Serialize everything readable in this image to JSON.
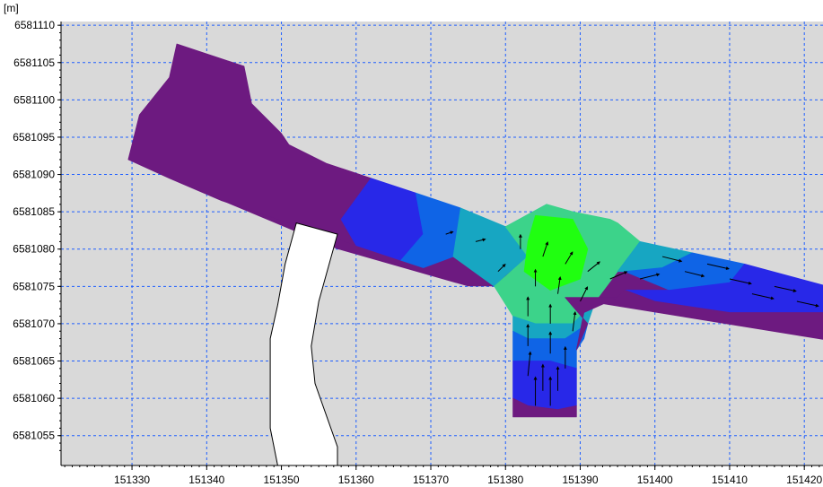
{
  "chart_data": {
    "type": "heatmap",
    "title": "",
    "xlabel": "",
    "ylabel": "",
    "y_unit": "[m]",
    "xlim": [
      151320.5,
      151422.5
    ],
    "ylim": [
      6581051,
      6581110.5
    ],
    "x_ticks": [
      151330,
      151340,
      151350,
      151360,
      151370,
      151380,
      151390,
      151400,
      151410,
      151420
    ],
    "y_ticks": [
      6581055,
      6581060,
      6581065,
      6581070,
      6581075,
      6581080,
      6581085,
      6581090,
      6581095,
      6581100,
      6581105,
      6581110
    ],
    "x_tick_labels": [
      "151330",
      "151340",
      "151350",
      "151360",
      "151370",
      "151380",
      "151390",
      "151400",
      "151410",
      "151420"
    ],
    "y_tick_labels": [
      "6581055",
      "6581060",
      "6581065",
      "6581070",
      "6581075",
      "6581080",
      "6581085",
      "6581090",
      "6581095",
      "6581100",
      "6581105",
      "6581110"
    ],
    "grid": true,
    "colors": {
      "background": "#d9d9d9",
      "grid": "#1f5fff",
      "low": "#6d1a80",
      "mid_low": "#2828e8",
      "mid": "#0f64e6",
      "mid_high": "#17a6c2",
      "high_low": "#3cd38a",
      "high": "#20ff10",
      "inflow_channel": "#ffffff"
    },
    "domain_outline": [
      [
        151336,
        6581107.5
      ],
      [
        151345,
        6581104.5
      ],
      [
        151346,
        6581099.5
      ],
      [
        151350,
        6581095.5
      ],
      [
        151351,
        6581094
      ],
      [
        151356,
        6581091.5
      ],
      [
        151360.5,
        6581090
      ],
      [
        151380,
        6581083
      ],
      [
        151385.5,
        6581086
      ],
      [
        151389,
        6581085
      ],
      [
        151394,
        6581084
      ],
      [
        151395,
        6581083.5
      ],
      [
        151398,
        6581081
      ],
      [
        151425,
        6581074.5
      ],
      [
        151425,
        6581067.5
      ],
      [
        151388,
        6581073.5
      ],
      [
        151395,
        6581073.5
      ],
      [
        151390.5,
        6581071.5
      ],
      [
        151389.5,
        6581066.5
      ],
      [
        151389.5,
        6581057.5
      ],
      [
        151381,
        6581057.5
      ],
      [
        151381,
        6581071
      ],
      [
        151378.5,
        6581075
      ],
      [
        151375,
        6581075
      ],
      [
        151357.5,
        6581080
      ],
      [
        151342,
        6581086.5
      ],
      [
        151335,
        6581089.5
      ],
      [
        151329.5,
        6581092
      ],
      [
        151331,
        6581098
      ],
      [
        151335,
        6581103
      ]
    ],
    "regions": [
      {
        "level": "low",
        "polygon": [
          [
            151336,
            6581107.5
          ],
          [
            151345,
            6581104.5
          ],
          [
            151346,
            6581099.5
          ],
          [
            151350,
            6581095.5
          ],
          [
            151351,
            6581094
          ],
          [
            151356,
            6581091.5
          ],
          [
            151362,
            6581089.5
          ],
          [
            151360,
            6581080.5
          ],
          [
            151342,
            6581086.5
          ],
          [
            151335,
            6581089.5
          ],
          [
            151329.5,
            6581092
          ],
          [
            151331,
            6581098
          ],
          [
            151335,
            6581103
          ]
        ]
      },
      {
        "level": "mid_low",
        "polygon": [
          [
            151362,
            6581089.5
          ],
          [
            151368,
            6581087.5
          ],
          [
            151369,
            6581082
          ],
          [
            151366,
            6581078.5
          ],
          [
            151360,
            6581080.5
          ],
          [
            151358,
            6581084
          ]
        ]
      },
      {
        "level": "mid",
        "polygon": [
          [
            151368,
            6581087.5
          ],
          [
            151374,
            6581085.5
          ],
          [
            151373,
            6581079
          ],
          [
            151369,
            6581077.5
          ],
          [
            151366,
            6581078.5
          ],
          [
            151369,
            6581082
          ]
        ]
      },
      {
        "level": "mid_high",
        "polygon": [
          [
            151374,
            6581085.5
          ],
          [
            151380,
            6581083
          ],
          [
            151385.5,
            6581086
          ],
          [
            151383,
            6581079
          ],
          [
            151380,
            6581076.5
          ],
          [
            151378.5,
            6581075
          ],
          [
            151373,
            6581079
          ]
        ]
      },
      {
        "level": "high_low",
        "polygon": [
          [
            151380,
            6581083
          ],
          [
            151385.5,
            6581086
          ],
          [
            151389,
            6581085
          ],
          [
            151394,
            6581084
          ],
          [
            151395,
            6581083.5
          ],
          [
            151398,
            6581081
          ],
          [
            151395,
            6581077
          ],
          [
            151392,
            6581073
          ],
          [
            151389,
            6581070
          ],
          [
            151384,
            6581070
          ],
          [
            151381,
            6581071
          ],
          [
            151378.5,
            6581075
          ],
          [
            151383,
            6581079
          ]
        ]
      },
      {
        "level": "high",
        "polygon": [
          [
            151384,
            6581084.5
          ],
          [
            151389,
            6581084
          ],
          [
            151391,
            6581080
          ],
          [
            151390,
            6581076
          ],
          [
            151386,
            6581074.5
          ],
          [
            151382.5,
            6581077
          ],
          [
            151383,
            6581081
          ]
        ]
      },
      {
        "level": "mid_high",
        "polygon": [
          [
            151398,
            6581081
          ],
          [
            151405,
            6581079.5
          ],
          [
            151401,
            6581077.5
          ],
          [
            151396,
            6581077
          ],
          [
            151395,
            6581077
          ]
        ]
      },
      {
        "level": "mid",
        "polygon": [
          [
            151405,
            6581079.5
          ],
          [
            151412,
            6581078
          ],
          [
            151410,
            6581075.5
          ],
          [
            151402,
            6581074.5
          ],
          [
            151396,
            6581077
          ],
          [
            151401,
            6581077.5
          ]
        ]
      },
      {
        "level": "mid_low",
        "polygon": [
          [
            151412,
            6581078
          ],
          [
            151425,
            6581074.5
          ],
          [
            151425,
            6581071.5
          ],
          [
            151410,
            6581071.5
          ],
          [
            151400,
            6581073
          ],
          [
            151396,
            6581074.5
          ],
          [
            151402,
            6581074.5
          ],
          [
            151410,
            6581075.5
          ]
        ]
      },
      {
        "level": "low",
        "polygon": [
          [
            151396,
            6581074.5
          ],
          [
            151400,
            6581073
          ],
          [
            151410,
            6581071.5
          ],
          [
            151425,
            6581071.5
          ],
          [
            151425,
            6581067.5
          ],
          [
            151388,
            6581073.5
          ],
          [
            151395,
            6581073.5
          ]
        ]
      },
      {
        "level": "mid_high",
        "polygon": [
          [
            151381,
            6581071
          ],
          [
            151384,
            6581070
          ],
          [
            151389,
            6581070
          ],
          [
            151392,
            6581073
          ],
          [
            151391,
            6581070
          ],
          [
            151388,
            6581068
          ],
          [
            151383,
            6581068
          ],
          [
            151381,
            6581069
          ]
        ]
      },
      {
        "level": "mid",
        "polygon": [
          [
            151381,
            6581069
          ],
          [
            151383,
            6581068
          ],
          [
            151388,
            6581068
          ],
          [
            151391,
            6581070
          ],
          [
            151390.5,
            6581068
          ],
          [
            151389.5,
            6581066.5
          ],
          [
            151389.5,
            6581064
          ],
          [
            151386,
            6581065
          ],
          [
            151381,
            6581065
          ]
        ]
      },
      {
        "level": "mid_low",
        "polygon": [
          [
            151381,
            6581065
          ],
          [
            151386,
            6581065
          ],
          [
            151389.5,
            6581064
          ],
          [
            151389.5,
            6581059
          ],
          [
            151387,
            6581058.5
          ],
          [
            151383,
            6581059
          ],
          [
            151381,
            6581060
          ]
        ]
      },
      {
        "level": "low",
        "polygon": [
          [
            151381,
            6581060
          ],
          [
            151383,
            6581059
          ],
          [
            151387,
            6581058.5
          ],
          [
            151389.5,
            6581059
          ],
          [
            151389.5,
            6581057.5
          ],
          [
            151381,
            6581057.5
          ]
        ]
      },
      {
        "level": "low",
        "polygon": [
          [
            151389.5,
            6581066.5
          ],
          [
            151390.5,
            6581071.5
          ],
          [
            151395,
            6581073.5
          ],
          [
            151388,
            6581073.5
          ],
          [
            151391,
            6581070
          ]
        ]
      }
    ],
    "inflow_channel": [
      [
        151352,
        6581083.5
      ],
      [
        151357.5,
        6581082
      ],
      [
        151355,
        6581073
      ],
      [
        151354,
        6581067
      ],
      [
        151354.5,
        6581062
      ],
      [
        151357.5,
        6581053.5
      ],
      [
        151357.5,
        6581051
      ],
      [
        151349.5,
        6581051
      ],
      [
        151348.5,
        6581056
      ],
      [
        151348.5,
        6581062
      ],
      [
        151348.5,
        6581068
      ],
      [
        151349.5,
        6581072.5
      ],
      [
        151350.5,
        6581078
      ]
    ],
    "vectors": [
      {
        "x": 151382,
        "y": 6581080,
        "dx": 0.0,
        "dy": 0.6
      },
      {
        "x": 151385,
        "y": 6581079,
        "dx": 0.2,
        "dy": 0.6
      },
      {
        "x": 151388,
        "y": 6581078,
        "dx": 0.3,
        "dy": 0.5
      },
      {
        "x": 151391,
        "y": 6581077,
        "dx": 0.5,
        "dy": 0.4
      },
      {
        "x": 151384,
        "y": 6581075,
        "dx": 0.0,
        "dy": 0.7
      },
      {
        "x": 151387,
        "y": 6581074,
        "dx": 0.1,
        "dy": 0.7
      },
      {
        "x": 151390,
        "y": 6581073,
        "dx": 0.3,
        "dy": 0.6
      },
      {
        "x": 151383,
        "y": 6581071,
        "dx": 0.0,
        "dy": 0.8
      },
      {
        "x": 151386,
        "y": 6581070,
        "dx": 0.0,
        "dy": 0.8
      },
      {
        "x": 151389,
        "y": 6581069,
        "dx": 0.1,
        "dy": 0.8
      },
      {
        "x": 151383,
        "y": 6581067,
        "dx": 0.0,
        "dy": 0.9
      },
      {
        "x": 151386,
        "y": 6581066,
        "dx": 0.0,
        "dy": 0.9
      },
      {
        "x": 151388,
        "y": 6581064,
        "dx": 0.0,
        "dy": 0.9
      },
      {
        "x": 151383,
        "y": 6581063,
        "dx": 0.1,
        "dy": 1.0
      },
      {
        "x": 151385,
        "y": 6581061,
        "dx": 0.0,
        "dy": 1.1
      },
      {
        "x": 151387,
        "y": 6581061,
        "dx": 0.0,
        "dy": 1.0
      },
      {
        "x": 151384,
        "y": 6581059,
        "dx": 0.0,
        "dy": 1.2
      },
      {
        "x": 151386,
        "y": 6581059,
        "dx": 0.0,
        "dy": 1.2
      },
      {
        "x": 151394,
        "y": 6581076,
        "dx": 0.7,
        "dy": 0.3
      },
      {
        "x": 151398,
        "y": 6581076,
        "dx": 0.8,
        "dy": 0.2
      },
      {
        "x": 151401,
        "y": 6581079,
        "dx": 0.8,
        "dy": -0.2
      },
      {
        "x": 151404,
        "y": 6581077,
        "dx": 0.8,
        "dy": -0.2
      },
      {
        "x": 151407,
        "y": 6581078,
        "dx": 0.9,
        "dy": -0.2
      },
      {
        "x": 151410,
        "y": 6581076,
        "dx": 0.9,
        "dy": -0.2
      },
      {
        "x": 151413,
        "y": 6581074,
        "dx": 0.9,
        "dy": -0.2
      },
      {
        "x": 151416,
        "y": 6581075,
        "dx": 0.9,
        "dy": -0.2
      },
      {
        "x": 151419,
        "y": 6581073,
        "dx": 0.9,
        "dy": -0.2
      },
      {
        "x": 151372,
        "y": 6581082,
        "dx": 0.3,
        "dy": 0.1
      },
      {
        "x": 151376,
        "y": 6581081,
        "dx": 0.4,
        "dy": 0.1
      },
      {
        "x": 151379,
        "y": 6581077,
        "dx": 0.3,
        "dy": 0.3
      }
    ]
  }
}
